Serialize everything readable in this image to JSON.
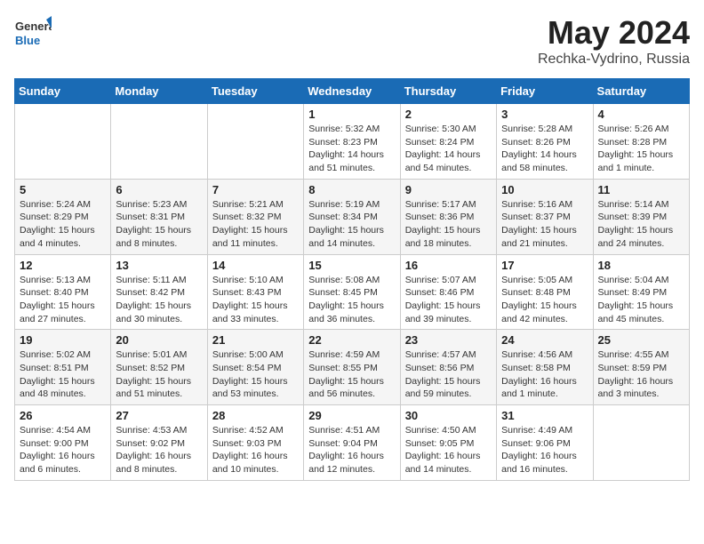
{
  "header": {
    "logo_general": "General",
    "logo_blue": "Blue",
    "title": "May 2024",
    "location": "Rechka-Vydrino, Russia"
  },
  "weekdays": [
    "Sunday",
    "Monday",
    "Tuesday",
    "Wednesday",
    "Thursday",
    "Friday",
    "Saturday"
  ],
  "weeks": [
    [
      {
        "day": "",
        "info": ""
      },
      {
        "day": "",
        "info": ""
      },
      {
        "day": "",
        "info": ""
      },
      {
        "day": "1",
        "info": "Sunrise: 5:32 AM\nSunset: 8:23 PM\nDaylight: 14 hours\nand 51 minutes."
      },
      {
        "day": "2",
        "info": "Sunrise: 5:30 AM\nSunset: 8:24 PM\nDaylight: 14 hours\nand 54 minutes."
      },
      {
        "day": "3",
        "info": "Sunrise: 5:28 AM\nSunset: 8:26 PM\nDaylight: 14 hours\nand 58 minutes."
      },
      {
        "day": "4",
        "info": "Sunrise: 5:26 AM\nSunset: 8:28 PM\nDaylight: 15 hours\nand 1 minute."
      }
    ],
    [
      {
        "day": "5",
        "info": "Sunrise: 5:24 AM\nSunset: 8:29 PM\nDaylight: 15 hours\nand 4 minutes."
      },
      {
        "day": "6",
        "info": "Sunrise: 5:23 AM\nSunset: 8:31 PM\nDaylight: 15 hours\nand 8 minutes."
      },
      {
        "day": "7",
        "info": "Sunrise: 5:21 AM\nSunset: 8:32 PM\nDaylight: 15 hours\nand 11 minutes."
      },
      {
        "day": "8",
        "info": "Sunrise: 5:19 AM\nSunset: 8:34 PM\nDaylight: 15 hours\nand 14 minutes."
      },
      {
        "day": "9",
        "info": "Sunrise: 5:17 AM\nSunset: 8:36 PM\nDaylight: 15 hours\nand 18 minutes."
      },
      {
        "day": "10",
        "info": "Sunrise: 5:16 AM\nSunset: 8:37 PM\nDaylight: 15 hours\nand 21 minutes."
      },
      {
        "day": "11",
        "info": "Sunrise: 5:14 AM\nSunset: 8:39 PM\nDaylight: 15 hours\nand 24 minutes."
      }
    ],
    [
      {
        "day": "12",
        "info": "Sunrise: 5:13 AM\nSunset: 8:40 PM\nDaylight: 15 hours\nand 27 minutes."
      },
      {
        "day": "13",
        "info": "Sunrise: 5:11 AM\nSunset: 8:42 PM\nDaylight: 15 hours\nand 30 minutes."
      },
      {
        "day": "14",
        "info": "Sunrise: 5:10 AM\nSunset: 8:43 PM\nDaylight: 15 hours\nand 33 minutes."
      },
      {
        "day": "15",
        "info": "Sunrise: 5:08 AM\nSunset: 8:45 PM\nDaylight: 15 hours\nand 36 minutes."
      },
      {
        "day": "16",
        "info": "Sunrise: 5:07 AM\nSunset: 8:46 PM\nDaylight: 15 hours\nand 39 minutes."
      },
      {
        "day": "17",
        "info": "Sunrise: 5:05 AM\nSunset: 8:48 PM\nDaylight: 15 hours\nand 42 minutes."
      },
      {
        "day": "18",
        "info": "Sunrise: 5:04 AM\nSunset: 8:49 PM\nDaylight: 15 hours\nand 45 minutes."
      }
    ],
    [
      {
        "day": "19",
        "info": "Sunrise: 5:02 AM\nSunset: 8:51 PM\nDaylight: 15 hours\nand 48 minutes."
      },
      {
        "day": "20",
        "info": "Sunrise: 5:01 AM\nSunset: 8:52 PM\nDaylight: 15 hours\nand 51 minutes."
      },
      {
        "day": "21",
        "info": "Sunrise: 5:00 AM\nSunset: 8:54 PM\nDaylight: 15 hours\nand 53 minutes."
      },
      {
        "day": "22",
        "info": "Sunrise: 4:59 AM\nSunset: 8:55 PM\nDaylight: 15 hours\nand 56 minutes."
      },
      {
        "day": "23",
        "info": "Sunrise: 4:57 AM\nSunset: 8:56 PM\nDaylight: 15 hours\nand 59 minutes."
      },
      {
        "day": "24",
        "info": "Sunrise: 4:56 AM\nSunset: 8:58 PM\nDaylight: 16 hours\nand 1 minute."
      },
      {
        "day": "25",
        "info": "Sunrise: 4:55 AM\nSunset: 8:59 PM\nDaylight: 16 hours\nand 3 minutes."
      }
    ],
    [
      {
        "day": "26",
        "info": "Sunrise: 4:54 AM\nSunset: 9:00 PM\nDaylight: 16 hours\nand 6 minutes."
      },
      {
        "day": "27",
        "info": "Sunrise: 4:53 AM\nSunset: 9:02 PM\nDaylight: 16 hours\nand 8 minutes."
      },
      {
        "day": "28",
        "info": "Sunrise: 4:52 AM\nSunset: 9:03 PM\nDaylight: 16 hours\nand 10 minutes."
      },
      {
        "day": "29",
        "info": "Sunrise: 4:51 AM\nSunset: 9:04 PM\nDaylight: 16 hours\nand 12 minutes."
      },
      {
        "day": "30",
        "info": "Sunrise: 4:50 AM\nSunset: 9:05 PM\nDaylight: 16 hours\nand 14 minutes."
      },
      {
        "day": "31",
        "info": "Sunrise: 4:49 AM\nSunset: 9:06 PM\nDaylight: 16 hours\nand 16 minutes."
      },
      {
        "day": "",
        "info": ""
      }
    ]
  ]
}
